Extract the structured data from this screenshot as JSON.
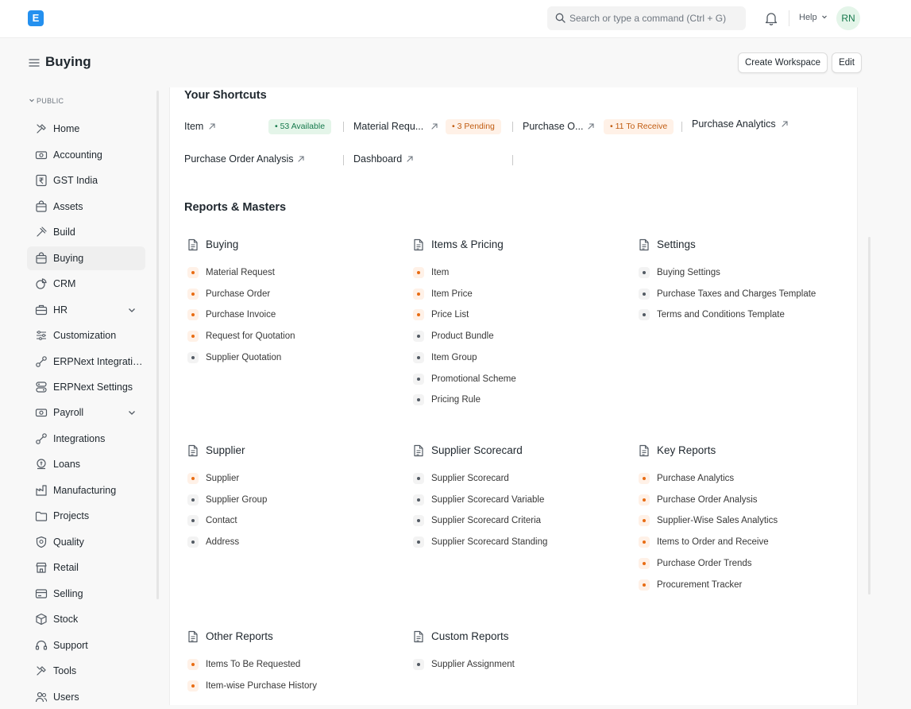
{
  "app": {
    "logo_letter": "E"
  },
  "search": {
    "placeholder": "Search or type a command (Ctrl + G)"
  },
  "header": {
    "help_label": "Help",
    "avatar_initials": "RN"
  },
  "page": {
    "title": "Buying",
    "create_workspace_label": "Create Workspace",
    "edit_label": "Edit"
  },
  "sidebar": {
    "section_label": "PUBLIC",
    "items": [
      {
        "label": "Home",
        "icon": "tools-icon"
      },
      {
        "label": "Accounting",
        "icon": "money-icon"
      },
      {
        "label": "GST India",
        "icon": "rupee-icon"
      },
      {
        "label": "Assets",
        "icon": "bag-icon"
      },
      {
        "label": "Build",
        "icon": "hammer-icon"
      },
      {
        "label": "Buying",
        "icon": "bag-icon",
        "active": true
      },
      {
        "label": "CRM",
        "icon": "chart-icon"
      },
      {
        "label": "HR",
        "icon": "briefcase-icon",
        "expandable": true
      },
      {
        "label": "Customization",
        "icon": "sliders-icon"
      },
      {
        "label": "ERPNext Integrations",
        "icon": "integration-icon"
      },
      {
        "label": "ERPNext Settings",
        "icon": "settings-icon"
      },
      {
        "label": "Payroll",
        "icon": "money-icon",
        "expandable": true
      },
      {
        "label": "Integrations",
        "icon": "integration-icon"
      },
      {
        "label": "Loans",
        "icon": "loan-icon"
      },
      {
        "label": "Manufacturing",
        "icon": "factory-icon"
      },
      {
        "label": "Projects",
        "icon": "folder-icon"
      },
      {
        "label": "Quality",
        "icon": "quality-icon"
      },
      {
        "label": "Retail",
        "icon": "retail-icon"
      },
      {
        "label": "Selling",
        "icon": "card-icon"
      },
      {
        "label": "Stock",
        "icon": "box-icon"
      },
      {
        "label": "Support",
        "icon": "headset-icon"
      },
      {
        "label": "Tools",
        "icon": "tools-icon"
      },
      {
        "label": "Users",
        "icon": "users-icon"
      }
    ]
  },
  "shortcuts": {
    "title": "Your Shortcuts",
    "items": [
      {
        "label": "Item",
        "badge": "53 Available",
        "badge_color": "#16794c"
      },
      {
        "label": "Material Requ...",
        "badge": "3 Pending",
        "badge_color": "#c15d12"
      },
      {
        "label": "Purchase O...",
        "badge": "11 To Receive",
        "badge_color": "#c15d12"
      },
      {
        "label": "Purchase Analytics"
      },
      {
        "label": "Purchase Order Analysis"
      },
      {
        "label": "Dashboard"
      }
    ]
  },
  "reports": {
    "title": "Reports & Masters",
    "sections": [
      {
        "title": "Buying",
        "links": [
          {
            "label": "Material Request",
            "status": "orange"
          },
          {
            "label": "Purchase Order",
            "status": "orange"
          },
          {
            "label": "Purchase Invoice",
            "status": "orange"
          },
          {
            "label": "Request for Quotation",
            "status": "orange"
          },
          {
            "label": "Supplier Quotation",
            "status": "gray"
          }
        ]
      },
      {
        "title": "Items & Pricing",
        "links": [
          {
            "label": "Item",
            "status": "orange"
          },
          {
            "label": "Item Price",
            "status": "orange"
          },
          {
            "label": "Price List",
            "status": "orange"
          },
          {
            "label": "Product Bundle",
            "status": "gray"
          },
          {
            "label": "Item Group",
            "status": "gray"
          },
          {
            "label": "Promotional Scheme",
            "status": "gray"
          },
          {
            "label": "Pricing Rule",
            "status": "gray"
          }
        ]
      },
      {
        "title": "Settings",
        "links": [
          {
            "label": "Buying Settings",
            "status": "gray"
          },
          {
            "label": "Purchase Taxes and Charges Template",
            "status": "gray"
          },
          {
            "label": "Terms and Conditions Template",
            "status": "gray"
          }
        ]
      },
      {
        "title": "Supplier",
        "links": [
          {
            "label": "Supplier",
            "status": "orange"
          },
          {
            "label": "Supplier Group",
            "status": "gray"
          },
          {
            "label": "Contact",
            "status": "gray"
          },
          {
            "label": "Address",
            "status": "gray"
          }
        ]
      },
      {
        "title": "Supplier Scorecard",
        "links": [
          {
            "label": "Supplier Scorecard",
            "status": "gray"
          },
          {
            "label": "Supplier Scorecard Variable",
            "status": "gray"
          },
          {
            "label": "Supplier Scorecard Criteria",
            "status": "gray"
          },
          {
            "label": "Supplier Scorecard Standing",
            "status": "gray"
          }
        ]
      },
      {
        "title": "Key Reports",
        "links": [
          {
            "label": "Purchase Analytics",
            "status": "orange"
          },
          {
            "label": "Purchase Order Analysis",
            "status": "orange"
          },
          {
            "label": "Supplier-Wise Sales Analytics",
            "status": "orange"
          },
          {
            "label": "Items to Order and Receive",
            "status": "orange"
          },
          {
            "label": "Purchase Order Trends",
            "status": "orange"
          },
          {
            "label": "Procurement Tracker",
            "status": "orange"
          }
        ]
      },
      {
        "title": "Other Reports",
        "links": [
          {
            "label": "Items To Be Requested",
            "status": "orange"
          },
          {
            "label": "Item-wise Purchase History",
            "status": "orange"
          }
        ]
      },
      {
        "title": "Custom Reports",
        "links": [
          {
            "label": "Supplier Assignment",
            "status": "gray"
          }
        ]
      }
    ]
  }
}
